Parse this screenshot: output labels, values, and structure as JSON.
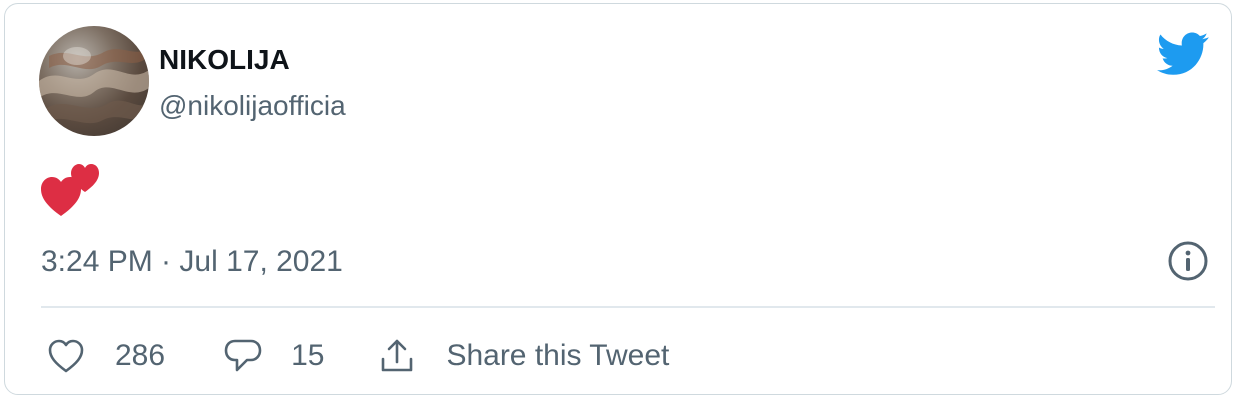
{
  "tweet": {
    "author": {
      "display_name": "NIKOLIJA",
      "handle": "@nikolijaofficia",
      "avatar_icon": "profile-photo"
    },
    "content_emoji": "two-hearts",
    "timestamp": "3:24 PM · Jul 17, 2021"
  },
  "actions": {
    "like_count": "286",
    "reply_count": "15",
    "share_label": "Share this Tweet"
  },
  "icons": {
    "brand": "twitter-bird-icon",
    "info": "info-icon",
    "like": "heart-outline-icon",
    "reply": "speech-bubble-icon",
    "share": "share-upload-icon"
  },
  "colors": {
    "brand_blue": "#1d9bf0",
    "heart_red": "#e0245e",
    "secondary_text": "#536471",
    "primary_text": "#0f1419",
    "border": "#cfd9de"
  }
}
